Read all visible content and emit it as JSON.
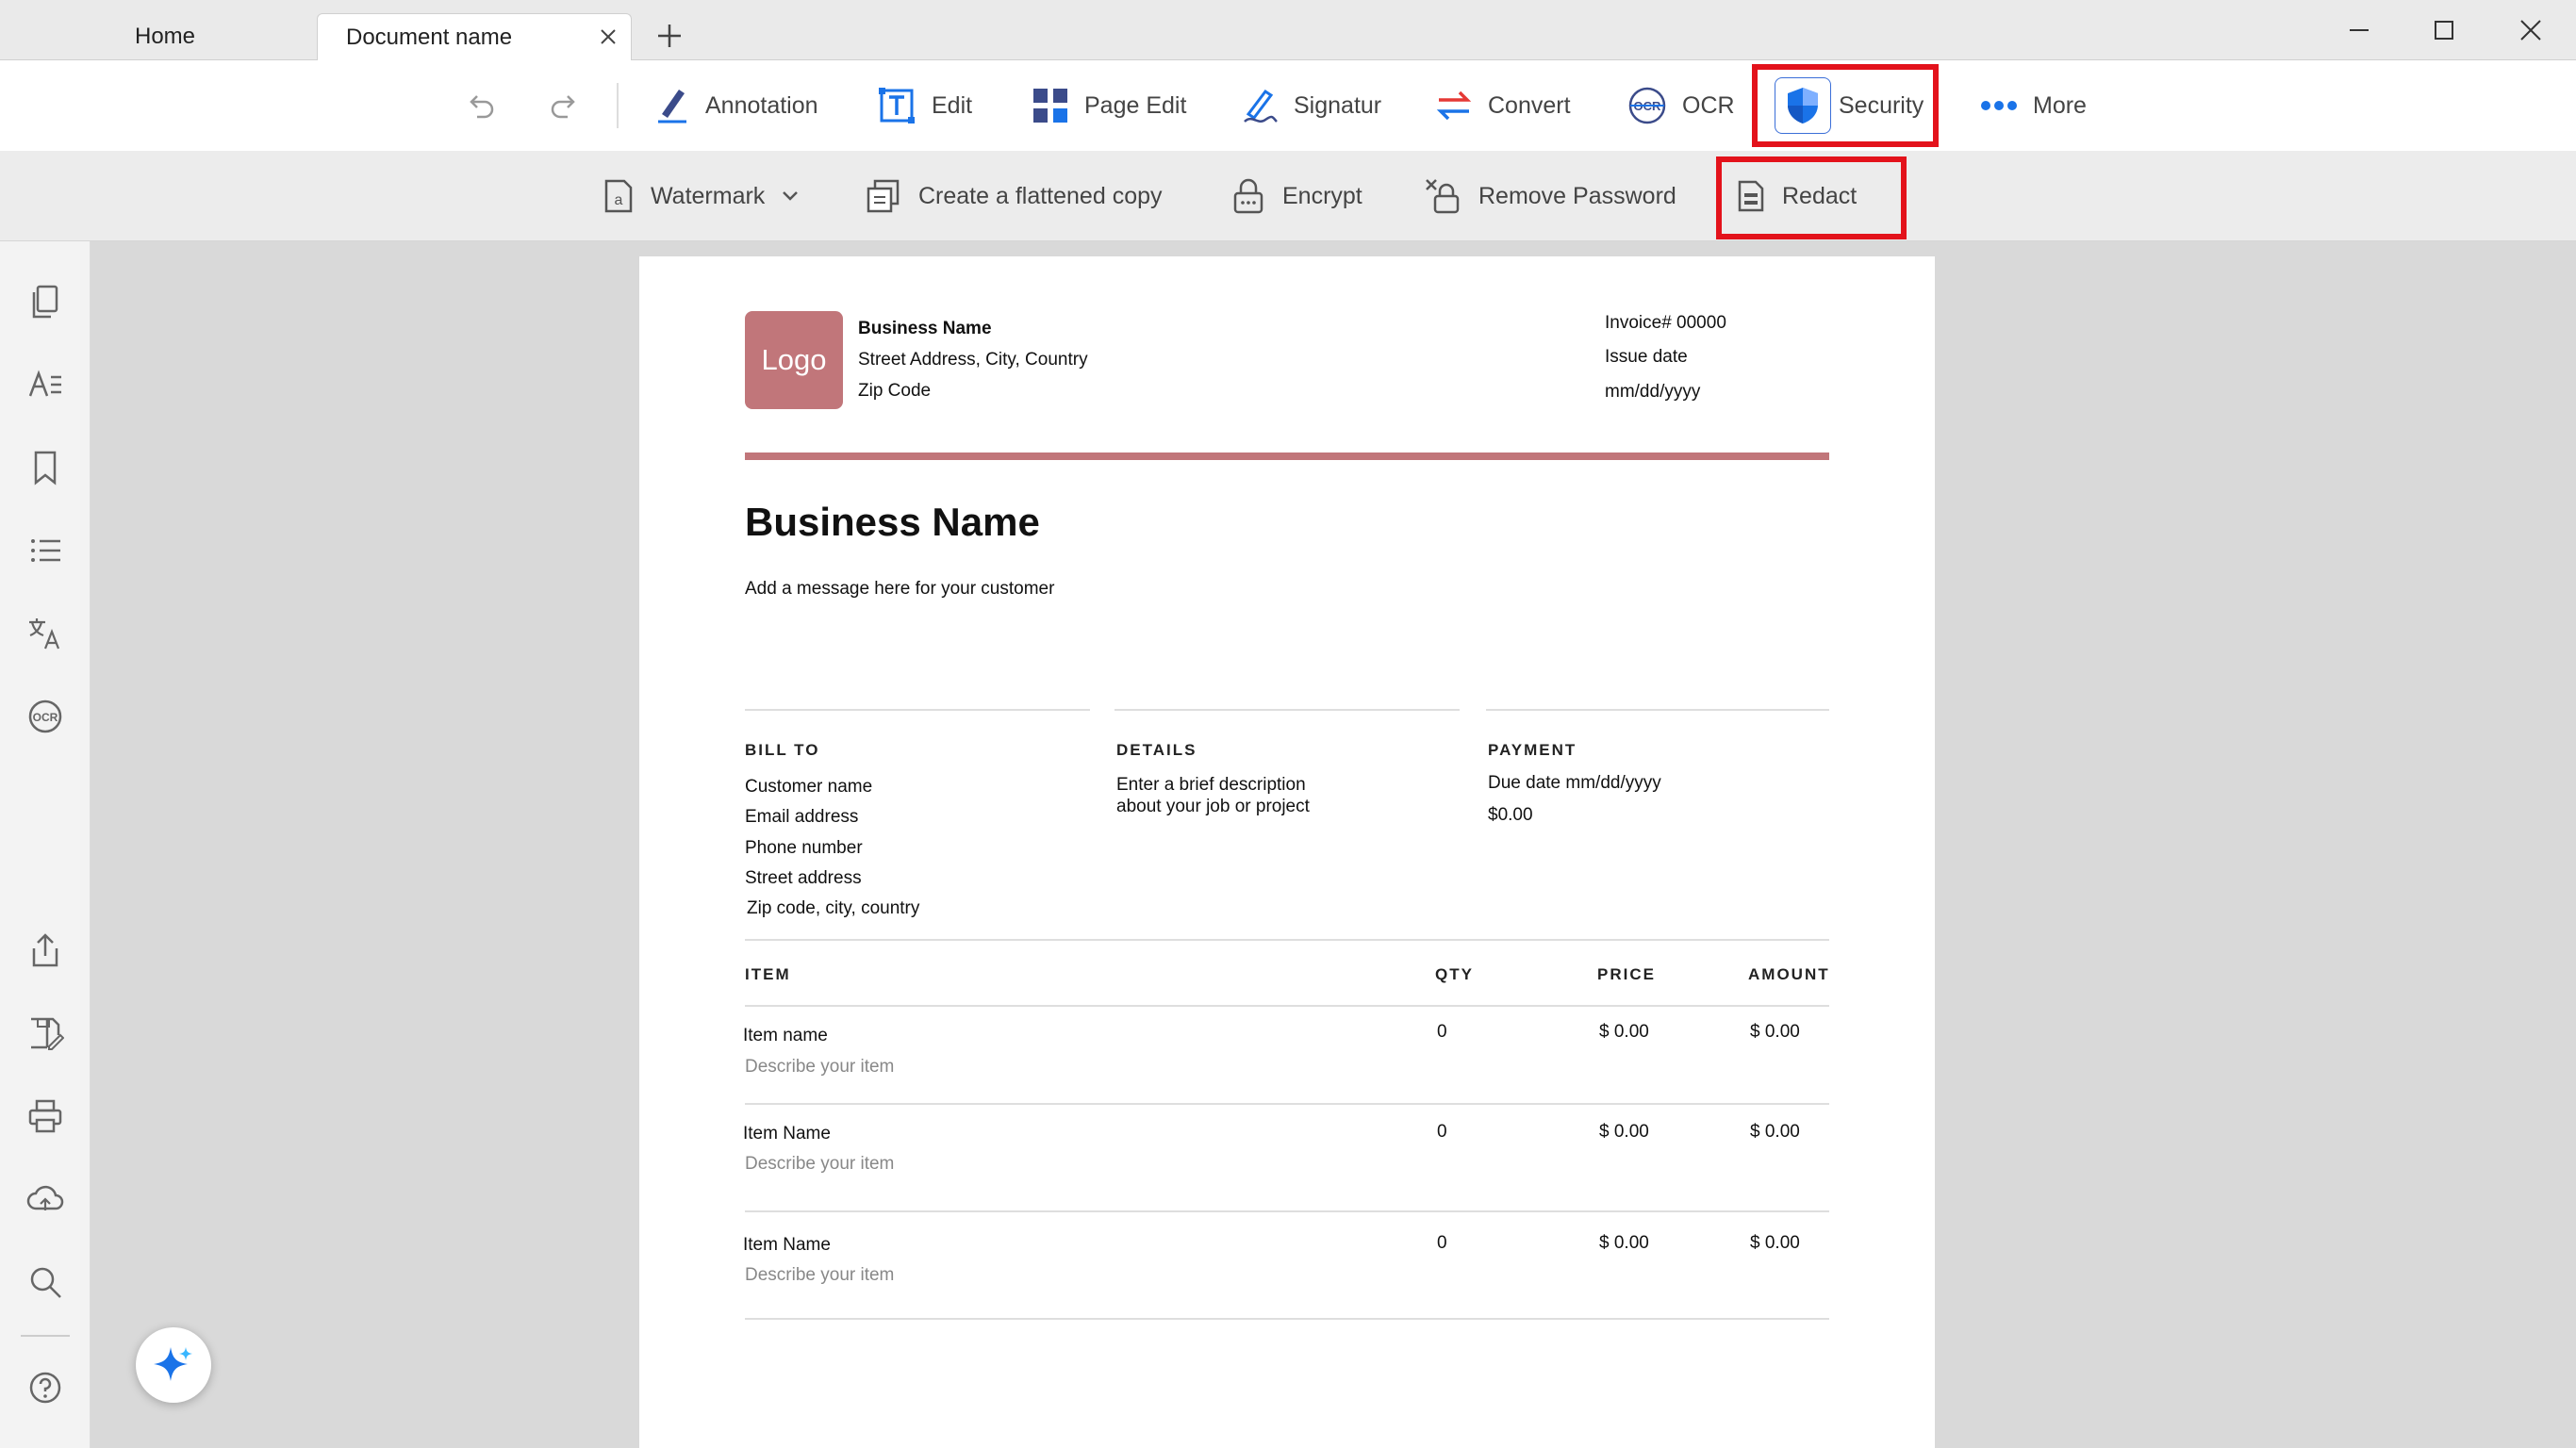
{
  "tabs": {
    "home": "Home",
    "document": "Document name"
  },
  "toolbar": {
    "annotation": "Annotation",
    "edit": "Edit",
    "page_edit": "Page Edit",
    "signature": "Signatur",
    "convert": "Convert",
    "ocr": "OCR",
    "security": "Security",
    "more": "More"
  },
  "security_bar": {
    "watermark": "Watermark",
    "flatten": "Create a flattened copy",
    "encrypt": "Encrypt",
    "remove_password": "Remove Password",
    "redact": "Redact"
  },
  "colors": {
    "highlight": "#e3121b",
    "accent": "#c1767a",
    "brand_blue": "#1a73e8"
  },
  "invoice": {
    "logo": "Logo",
    "business_name": "Business Name",
    "street": "Street Address, City, Country",
    "zip": "Zip Code",
    "invoice_no": "Invoice# 00000",
    "issue_date_label": "Issue date",
    "issue_date": "mm/dd/yyyy",
    "title": "Business Name",
    "message": "Add a message here for your customer",
    "bill_to": {
      "heading": "BILL TO",
      "lines": [
        "Customer name",
        "Email address",
        "Phone number",
        "Street address",
        "Zip code, city, country"
      ]
    },
    "details": {
      "heading": "DETAILS",
      "lines": [
        "Enter a brief description",
        "about your job or project"
      ]
    },
    "payment": {
      "heading": "PAYMENT",
      "lines": [
        "Due date mm/dd/yyyy",
        "$0.00"
      ]
    },
    "table": {
      "headers": {
        "item": "ITEM",
        "qty": "QTY",
        "price": "PRICE",
        "amount": "AMOUNT"
      },
      "rows": [
        {
          "name": "Item name",
          "desc": "Describe your item",
          "qty": "0",
          "price": "$ 0.00",
          "amount": "$ 0.00"
        },
        {
          "name": "Item Name",
          "desc": "Describe your item",
          "qty": "0",
          "price": "$ 0.00",
          "amount": "$ 0.00"
        },
        {
          "name": "Item Name",
          "desc": "Describe your item",
          "qty": "0",
          "price": "$ 0.00",
          "amount": "$ 0.00"
        }
      ]
    }
  }
}
